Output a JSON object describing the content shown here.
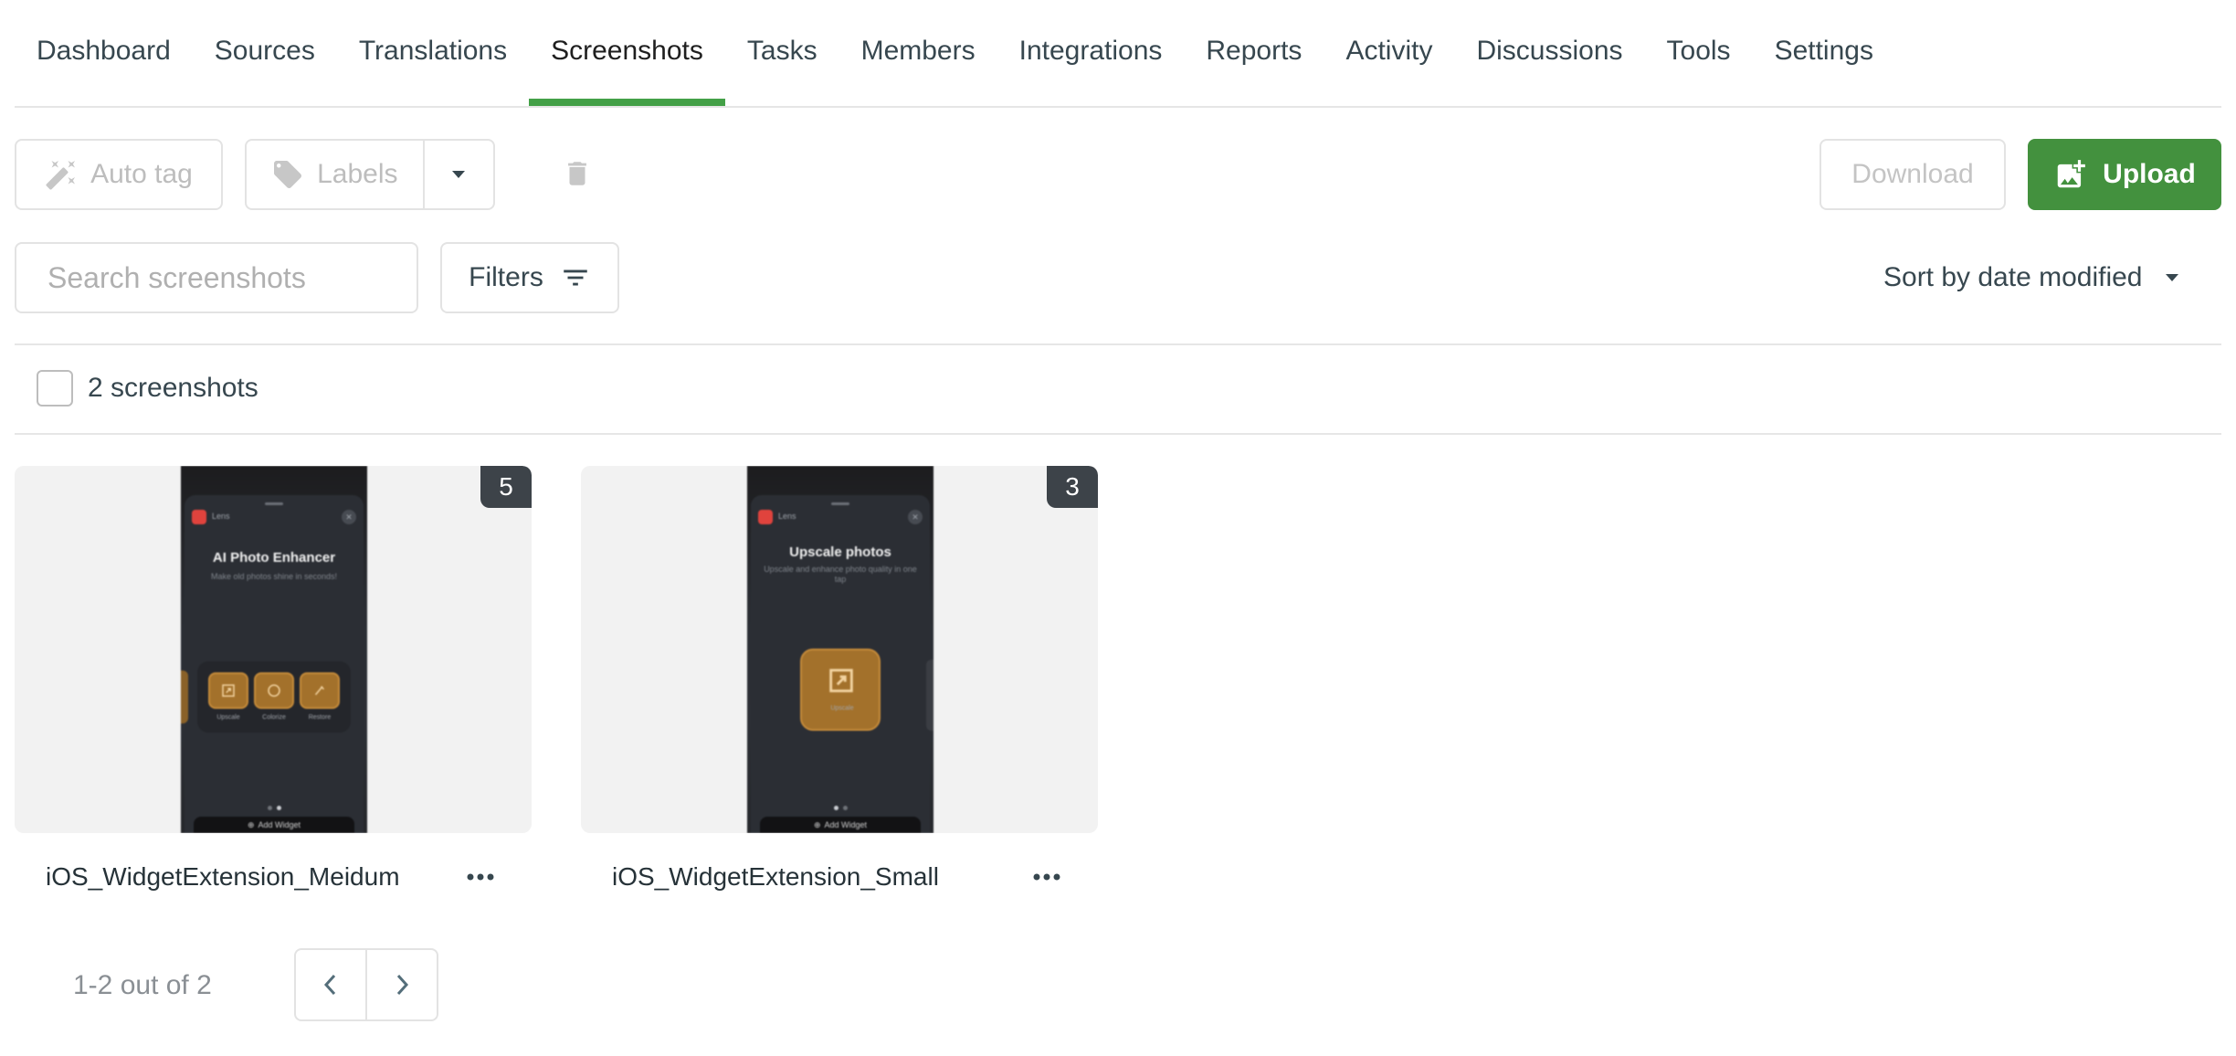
{
  "nav": {
    "tabs": [
      {
        "label": "Dashboard"
      },
      {
        "label": "Sources"
      },
      {
        "label": "Translations"
      },
      {
        "label": "Screenshots",
        "active": true
      },
      {
        "label": "Tasks"
      },
      {
        "label": "Members"
      },
      {
        "label": "Integrations"
      },
      {
        "label": "Reports"
      },
      {
        "label": "Activity"
      },
      {
        "label": "Discussions"
      },
      {
        "label": "Tools"
      },
      {
        "label": "Settings"
      }
    ]
  },
  "toolbar": {
    "autotag_label": "Auto tag",
    "labels_label": "Labels",
    "download_label": "Download",
    "upload_label": "Upload"
  },
  "search": {
    "placeholder": "Search screenshots"
  },
  "filters_label": "Filters",
  "sort_label": "Sort by date modified",
  "selection": {
    "count_label": "2 screenshots"
  },
  "screenshots": [
    {
      "name": "iOS_WidgetExtension_Meidum",
      "badge": "5",
      "preview": {
        "app_name": "Lens",
        "title": "AI Photo Enhancer",
        "subtitle": "Make old photos shine in seconds!",
        "tiles": [
          "Upscale",
          "Colorize",
          "Restore"
        ],
        "button": "Add Widget"
      }
    },
    {
      "name": "iOS_WidgetExtension_Small",
      "badge": "3",
      "preview": {
        "app_name": "Lens",
        "title": "Upscale photos",
        "subtitle": "Upscale and enhance photo quality in one tap",
        "tiles": [
          "Upscale"
        ],
        "button": "Add Widget"
      }
    }
  ],
  "pagination": {
    "label": "1-2 out of 2"
  },
  "colors": {
    "accent": "#43a047",
    "upload_bg": "#43913e",
    "badge_bg": "#3d4349"
  }
}
